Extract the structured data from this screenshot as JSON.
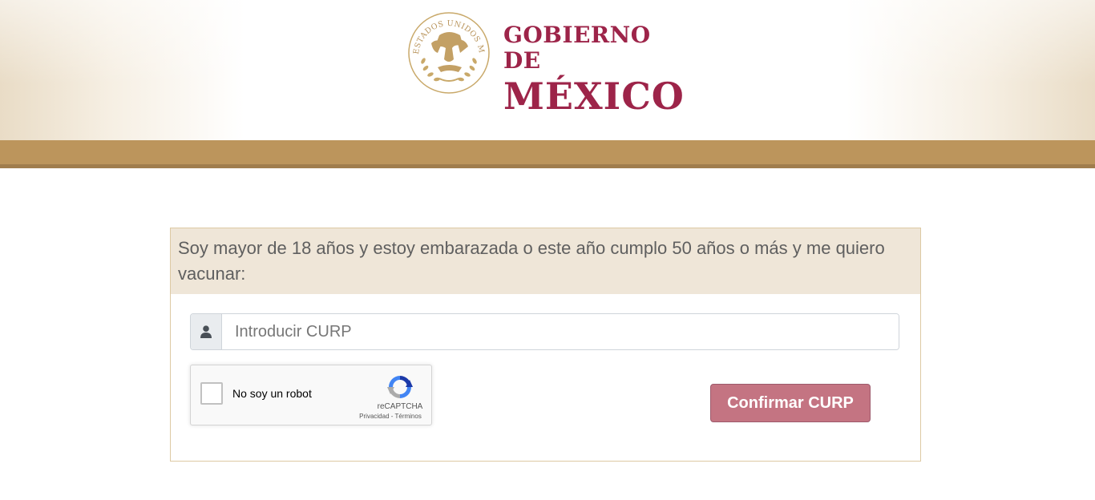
{
  "header": {
    "seal_text": "ESTADOS UNIDOS MEXICANOS",
    "brand_line1": "GOBIERNO DE",
    "brand_line2": "MÉXICO"
  },
  "form": {
    "heading": "Soy mayor de 18 años y estoy embarazada o este año cumplo 50 años o más y me quiero vacunar:",
    "curp_icon": "user-icon",
    "curp_placeholder": "Introducir CURP",
    "curp_value": "",
    "confirm_label": "Confirmar CURP"
  },
  "recaptcha": {
    "label": "No soy un robot",
    "brand": "reCAPTCHA",
    "links": "Privacidad - Términos",
    "checked": false
  },
  "colors": {
    "brand": "#9d2449",
    "gold": "#bc955c",
    "panel_heading_bg": "#efe6d8",
    "button": "#c47482"
  }
}
